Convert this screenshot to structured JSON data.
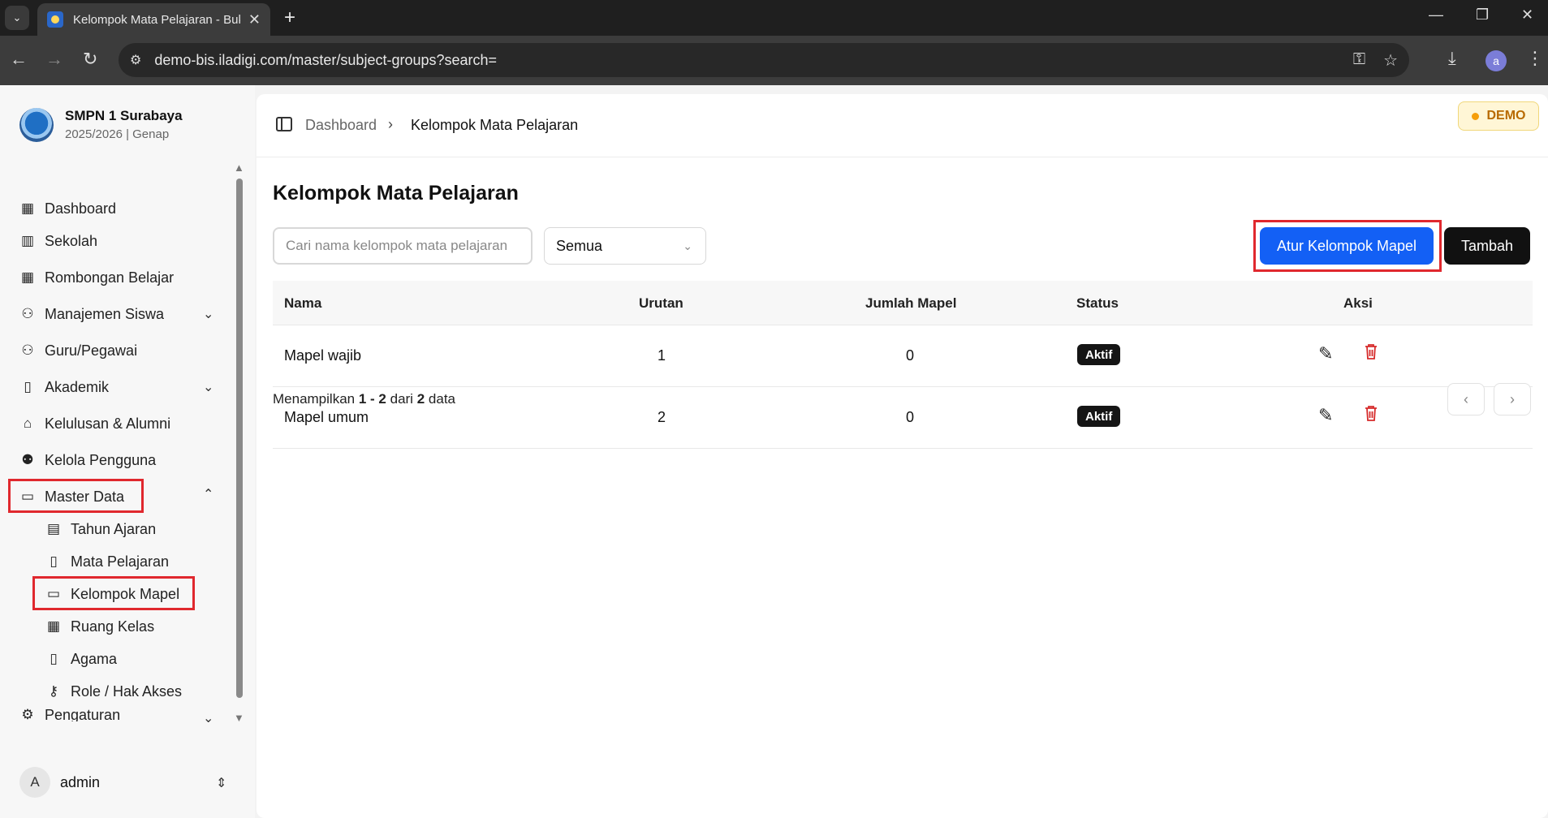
{
  "browser": {
    "tab_title": "Kelompok Mata Pelajaran - Buk",
    "url": "demo-bis.iladigi.com/master/subject-groups?search=",
    "profile_initial": "a"
  },
  "sidebar": {
    "school_name": "SMPN 1 Surabaya",
    "school_year": "2025/2026 | Genap",
    "items": [
      {
        "label": "Dashboard",
        "icon": "grid-icon"
      },
      {
        "label": "Sekolah",
        "icon": "building-icon"
      },
      {
        "label": "Rombongan Belajar",
        "icon": "grid-icon"
      },
      {
        "label": "Manajemen Siswa",
        "icon": "users-icon"
      },
      {
        "label": "Guru/Pegawai",
        "icon": "users-icon"
      },
      {
        "label": "Akademik",
        "icon": "book-icon"
      },
      {
        "label": "Kelulusan & Alumni",
        "icon": "graduation-cap-icon"
      },
      {
        "label": "Kelola Pengguna",
        "icon": "user-cog-icon"
      },
      {
        "label": "Master Data",
        "icon": "folder-icon"
      },
      {
        "label": "Pengaturan",
        "icon": "gear-icon"
      }
    ],
    "sub_items": [
      {
        "label": "Tahun Ajaran",
        "icon": "calendar-icon"
      },
      {
        "label": "Mata Pelajaran",
        "icon": "book-icon"
      },
      {
        "label": "Kelompok Mapel",
        "icon": "folder-icon"
      },
      {
        "label": "Ruang Kelas",
        "icon": "grid-icon"
      },
      {
        "label": "Agama",
        "icon": "book-icon"
      },
      {
        "label": "Role / Hak Akses",
        "icon": "key-icon"
      }
    ],
    "user": {
      "initial": "A",
      "name": "admin"
    }
  },
  "header": {
    "breadcrumb_root": "Dashboard",
    "breadcrumb_current": "Kelompok Mata Pelajaran",
    "badge": "DEMO"
  },
  "main": {
    "title": "Kelompok Mata Pelajaran",
    "search_placeholder": "Cari nama kelompok mata pelajaran",
    "filter_value": "Semua",
    "btn_manage": "Atur Kelompok Mapel",
    "btn_add": "Tambah",
    "columns": [
      "Nama",
      "Urutan",
      "Jumlah Mapel",
      "Status",
      "Aksi"
    ],
    "rows": [
      {
        "nama": "Mapel wajib",
        "urutan": "1",
        "jumlah": "0",
        "status": "Aktif"
      },
      {
        "nama": "Mapel umum",
        "urutan": "2",
        "jumlah": "0",
        "status": "Aktif"
      }
    ],
    "footer": {
      "prefix": "Menampilkan",
      "range": "1 - 2",
      "of": "dari",
      "total": "2",
      "suffix": "data"
    }
  },
  "colors": {
    "accent": "#1360f5",
    "highlight": "#e0282e",
    "danger": "#d62b2b",
    "demo_bg": "#fff6d6"
  }
}
